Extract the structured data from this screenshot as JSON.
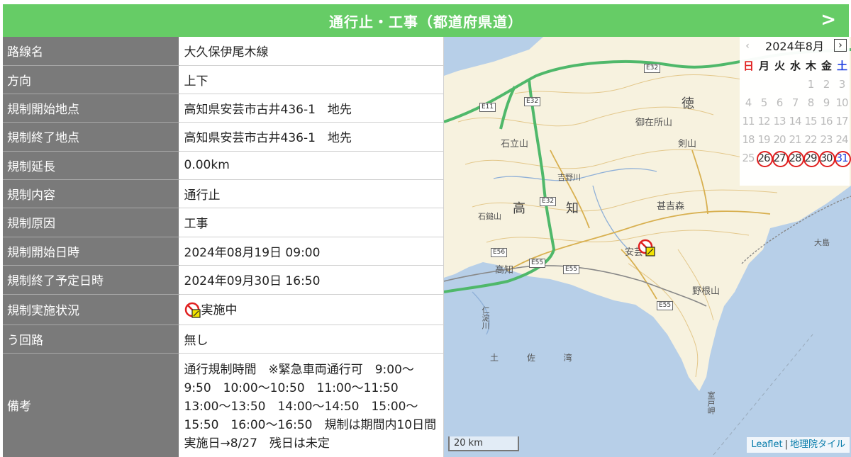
{
  "header": {
    "title": "通行止・工事（都道府県道）",
    "next_label": ">"
  },
  "rows": [
    {
      "label": "路線名",
      "value": "大久保伊尾木線"
    },
    {
      "label": "方向",
      "value": "上下"
    },
    {
      "label": "規制開始地点",
      "value": "高知県安芸市古井436-1　地先"
    },
    {
      "label": "規制終了地点",
      "value": "高知県安芸市古井436-1　地先"
    },
    {
      "label": "規制延長",
      "value": "0.00km"
    },
    {
      "label": "規制内容",
      "value": "通行止"
    },
    {
      "label": "規制原因",
      "value": "工事"
    },
    {
      "label": "規制開始日時",
      "value": "2024年08月19日 09:00"
    },
    {
      "label": "規制終了予定日時",
      "value": "2024年09月30日 16:50"
    },
    {
      "label": "規制実施状況",
      "value": "実施中",
      "icon": "road-closure-icon"
    },
    {
      "label": "う回路",
      "value": "無し"
    },
    {
      "label": "備考",
      "value": "通行規制時間　※緊急車両通行可　9:00～9:50　10:00～10:50　11:00～11:50　13:00～13:50　14:00～14:50　15:00～15:50　16:00～16:50　規制は期間内10日間　実施日→8/27　残日は未定"
    }
  ],
  "calendar": {
    "title": "2024年8月",
    "prev_label": "‹",
    "next_label": "›",
    "weekdays": [
      "日",
      "月",
      "火",
      "水",
      "木",
      "金",
      "土"
    ],
    "weeks": [
      [
        "",
        "",
        "",
        "",
        "1",
        "2",
        "3"
      ],
      [
        "4",
        "5",
        "6",
        "7",
        "8",
        "9",
        "10"
      ],
      [
        "11",
        "12",
        "13",
        "14",
        "15",
        "16",
        "17"
      ],
      [
        "18",
        "19",
        "20",
        "21",
        "22",
        "23",
        "24"
      ],
      [
        "25",
        "26",
        "27",
        "28",
        "29",
        "30",
        "31"
      ]
    ],
    "marked_days": [
      "26",
      "27",
      "28",
      "29",
      "30",
      "31"
    ],
    "colors": {
      "sunday": "#e02020",
      "saturday": "#2040e0",
      "mark": "#e02020"
    }
  },
  "map": {
    "labels": {
      "toku": "徳",
      "kou": "高",
      "chi": "知",
      "kochi_city": "高知",
      "kamou": "剣山",
      "gozaishomo": "御在所山",
      "ishidate": "石立山",
      "kouno": "甚吉森",
      "nohara": "野根山",
      "aki": "安芸",
      "tosa": "土 佐 湾",
      "muroto": "室戸岬",
      "oshima": "大島",
      "ishizuchi": "石鎚山",
      "niyodo": "仁淀川",
      "yoshino": "吉野川"
    },
    "shields": [
      "E32",
      "E11",
      "E32",
      "E32",
      "E56",
      "E55",
      "E55",
      "E55"
    ],
    "scale_label": "20 km",
    "attribution": {
      "leaflet": "Leaflet",
      "separator": "|",
      "tiles": "地理院タイル"
    },
    "colors": {
      "sea": "#b7cfe8",
      "land": "#f7f2df",
      "expressway": "#4fb86a",
      "road": "#d8b050"
    }
  },
  "colors": {
    "header": "#66cc66",
    "label_bg": "#7a7a7a"
  }
}
